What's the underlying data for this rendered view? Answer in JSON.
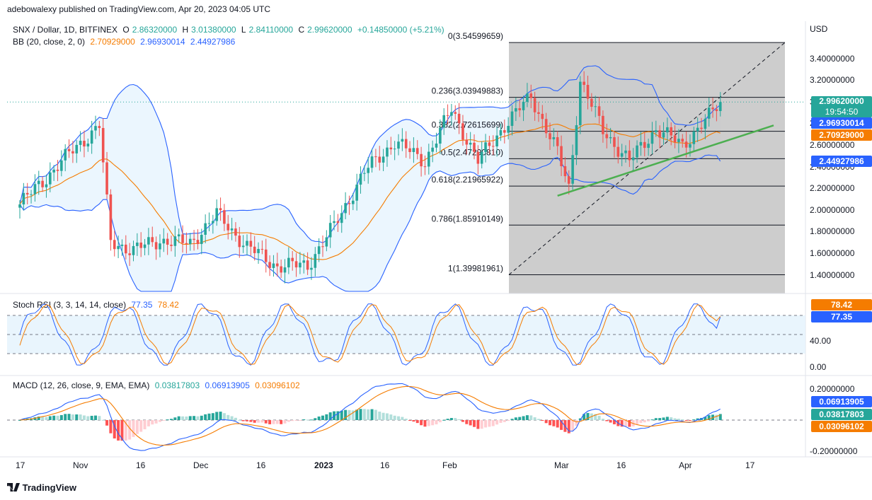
{
  "header": {
    "publisher": "adebowalexy published on TradingView.com, Apr 20, 2023 04:05 UTC"
  },
  "legend_main": {
    "symbol": "SNX / Dollar, 1D, BITFINEX",
    "o_label": "O",
    "o": "2.86320000",
    "h_label": "H",
    "h": "3.01380000",
    "l_label": "L",
    "l": "2.84110000",
    "c_label": "C",
    "c": "2.99620000",
    "change": "+0.14850000 (+5.21%)"
  },
  "legend_bb": {
    "name": "BB (20, close, 2, 0)",
    "basis": "2.70929000",
    "upper": "2.96930014",
    "lower": "2.44927986"
  },
  "legend_stoch": {
    "name": "Stoch RSI (3, 3, 14, 14, close)",
    "k": "77.35",
    "d": "78.42"
  },
  "legend_macd": {
    "name": "MACD (12, 26, close, 9, EMA, EMA)",
    "hist": "0.03817803",
    "macd": "0.06913905",
    "signal": "0.03096102"
  },
  "price_axis": {
    "currency": "USD",
    "ticks": [
      "3.40000000",
      "3.20000000",
      "3.00000000",
      "2.80000000",
      "2.60000000",
      "2.40000000",
      "2.20000000",
      "2.00000000",
      "1.80000000",
      "1.60000000",
      "1.40000000"
    ],
    "tags": [
      {
        "value": "2.99620000",
        "sub": "19:54:50",
        "color": "#26a69a"
      },
      {
        "value": "2.96930014",
        "color": "#2962ff"
      },
      {
        "value": "2.70929000",
        "color": "#f57c00"
      },
      {
        "value": "2.44927986",
        "color": "#2962ff"
      }
    ]
  },
  "stoch_axis": {
    "ticks": [
      "40.00",
      "0.00"
    ],
    "tag_d": "78.42",
    "tag_k": "77.35"
  },
  "macd_axis": {
    "ticks": [
      "0.20000000",
      "-0.20000000"
    ],
    "tag_macd": "0.06913905",
    "tag_hist": "0.03817803",
    "tag_signal": "0.03096102"
  },
  "x_axis": {
    "labels": [
      "17",
      "Nov",
      "16",
      "Dec",
      "16",
      "2023",
      "16",
      "Feb",
      "Mar",
      "16",
      "Apr",
      "17"
    ]
  },
  "fib": {
    "levels": [
      {
        "label": "0(3.54599659)",
        "price": 3.54599659
      },
      {
        "label": "0.236(3.03949883)",
        "price": 3.03949883
      },
      {
        "label": "0.382(2.72615699)",
        "price": 2.72615699
      },
      {
        "label": "0.5(2.47290810)",
        "price": 2.4729081
      },
      {
        "label": "0.618(2.21965922)",
        "price": 2.21965922
      },
      {
        "label": "0.786(1.85910149)",
        "price": 1.85910149
      },
      {
        "label": "1(1.39981961)",
        "price": 1.39981961
      }
    ]
  },
  "colors": {
    "up": "#26a69a",
    "down": "#ef5350",
    "bb_line": "#2962ff",
    "bb_fill": "#e3f2fd",
    "basis": "#f57c00",
    "fib_bg": "#c8c8c8",
    "trend": "#4caf50"
  },
  "footer": {
    "brand": "TradingView"
  },
  "chart_data": {
    "type": "candlestick",
    "title": "SNX / Dollar, 1D, BITFINEX",
    "ylabel": "USD",
    "ylim": [
      1.27,
      3.6
    ],
    "last": {
      "open": 2.8632,
      "high": 3.0138,
      "low": 2.8411,
      "close": 2.9962,
      "change": 0.1485,
      "change_pct": 5.21
    },
    "bollinger": {
      "basis": 2.70929,
      "upper": 2.96930014,
      "lower": 2.44927986
    },
    "stoch_rsi": {
      "k": 77.35,
      "d": 78.42,
      "ylim": [
        0,
        100
      ]
    },
    "macd": {
      "hist": 0.03817803,
      "macd": 0.06913905,
      "signal": 0.03096102
    },
    "close_path": [
      {
        "date": "Oct 17",
        "close": 2.05
      },
      {
        "date": "Oct 24",
        "close": 2.3
      },
      {
        "date": "Oct 31",
        "close": 2.55
      },
      {
        "date": "Nov 7",
        "close": 2.78
      },
      {
        "date": "Nov 10",
        "close": 1.7
      },
      {
        "date": "Nov 16",
        "close": 1.63
      },
      {
        "date": "Nov 23",
        "close": 1.72
      },
      {
        "date": "Dec 1",
        "close": 1.69
      },
      {
        "date": "Dec 8",
        "close": 1.96
      },
      {
        "date": "Dec 16",
        "close": 1.66
      },
      {
        "date": "Dec 24",
        "close": 1.48
      },
      {
        "date": "Jan 1",
        "close": 1.49
      },
      {
        "date": "Jan 8",
        "close": 1.85
      },
      {
        "date": "Jan 16",
        "close": 2.35
      },
      {
        "date": "Jan 24",
        "close": 2.63
      },
      {
        "date": "Feb 1",
        "close": 2.45
      },
      {
        "date": "Feb 8",
        "close": 2.93
      },
      {
        "date": "Feb 15",
        "close": 2.45
      },
      {
        "date": "Feb 22",
        "close": 2.78
      },
      {
        "date": "Mar 1",
        "close": 3.05
      },
      {
        "date": "Mar 8",
        "close": 2.53
      },
      {
        "date": "Mar 11",
        "close": 2.2
      },
      {
        "date": "Mar 14",
        "close": 3.2
      },
      {
        "date": "Mar 20",
        "close": 2.73
      },
      {
        "date": "Mar 27",
        "close": 2.45
      },
      {
        "date": "Apr 3",
        "close": 2.75
      },
      {
        "date": "Apr 10",
        "close": 2.6
      },
      {
        "date": "Apr 17",
        "close": 2.86
      },
      {
        "date": "Apr 20",
        "close": 2.9962
      }
    ]
  }
}
